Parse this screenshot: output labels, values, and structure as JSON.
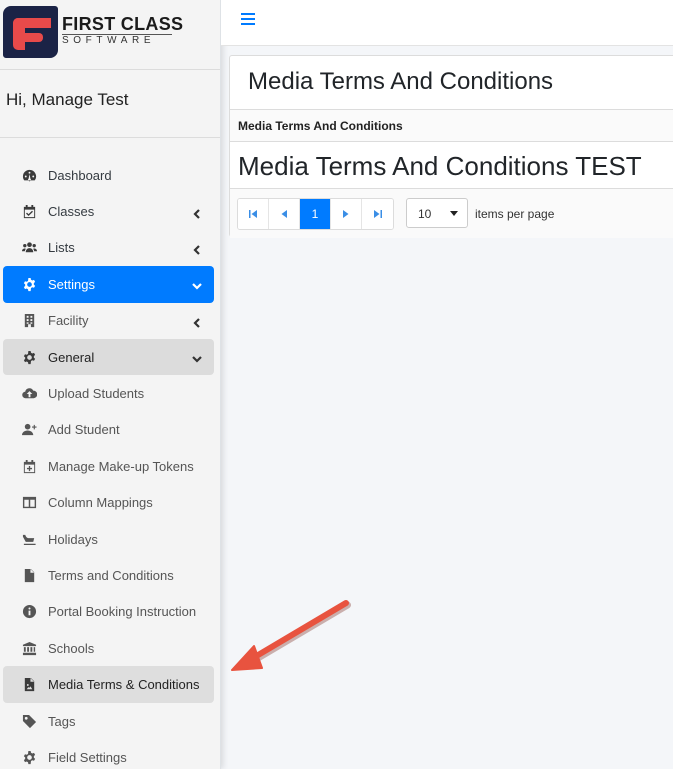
{
  "brand": {
    "line1": "FIRST CLASS",
    "line2": "SOFTWARE"
  },
  "user": {
    "greeting": "Hi, Manage Test"
  },
  "nav": {
    "dashboard": "Dashboard",
    "classes": "Classes",
    "lists": "Lists",
    "settings": "Settings",
    "facility": "Facility",
    "general": "General",
    "upload_students": "Upload Students",
    "add_student": "Add Student",
    "manage_tokens": "Manage Make-up Tokens",
    "column_mappings": "Column Mappings",
    "holidays": "Holidays",
    "terms": "Terms and Conditions",
    "portal_booking": "Portal Booking Instruction",
    "schools": "Schools",
    "media_terms": "Media Terms & Conditions",
    "tags": "Tags",
    "field_settings": "Field Settings"
  },
  "page": {
    "title": "Media Terms And Conditions",
    "column_header": "Media Terms And Conditions",
    "rows": [
      "Media Terms And Conditions TEST"
    ]
  },
  "pager": {
    "current_page": "1",
    "page_size": "10",
    "items_per_page_label": "items per page"
  },
  "colors": {
    "primary": "#007bff",
    "annotation_arrow": "#e8533f"
  }
}
